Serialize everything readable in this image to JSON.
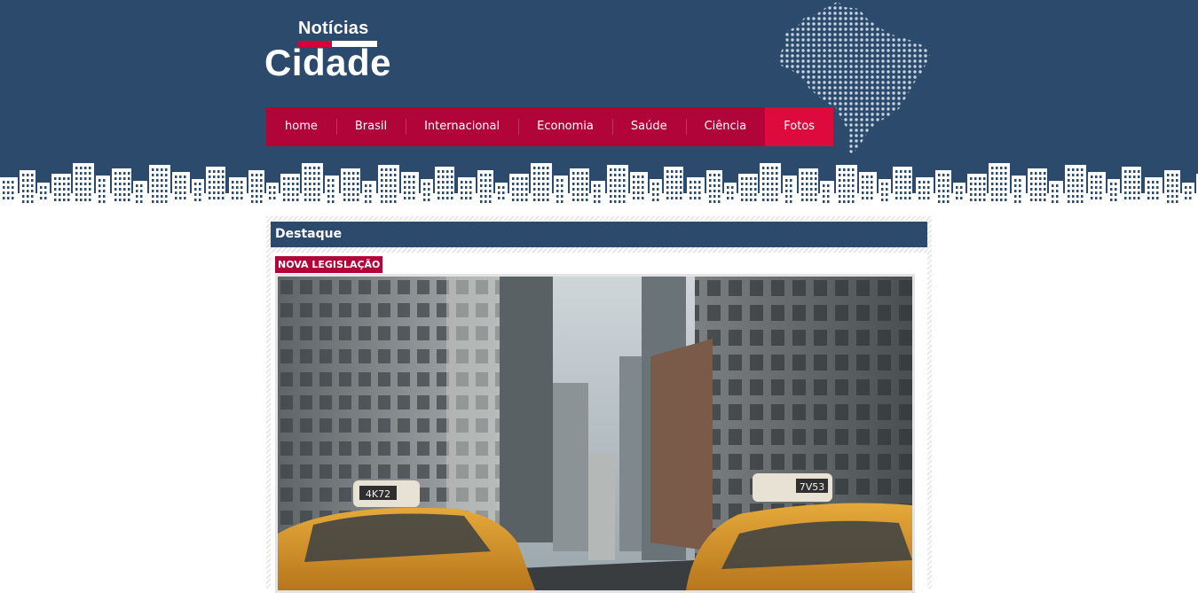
{
  "logo": {
    "top_text": "Notícias",
    "main_text": "Cidade"
  },
  "nav": {
    "items": [
      {
        "label": "home",
        "active": false
      },
      {
        "label": "Brasil",
        "active": false
      },
      {
        "label": "Internacional",
        "active": false
      },
      {
        "label": "Economia",
        "active": false
      },
      {
        "label": "Saúde",
        "active": false
      },
      {
        "label": "Ciência",
        "active": false
      },
      {
        "label": "Fotos",
        "active": true
      }
    ]
  },
  "featured": {
    "section_title": "Destaque",
    "tag": "NOVA LEGISLAÇÃO",
    "taxi_left_plate": "4K72",
    "taxi_right_plate": "7V53"
  },
  "colors": {
    "header_bg": "#2b4a6c",
    "nav_bg": "#b1053a",
    "nav_active": "#dd0a3e",
    "accent_red": "#d8003a"
  },
  "icons": [
    "brazil-map-graphic",
    "city-skyline-graphic"
  ]
}
